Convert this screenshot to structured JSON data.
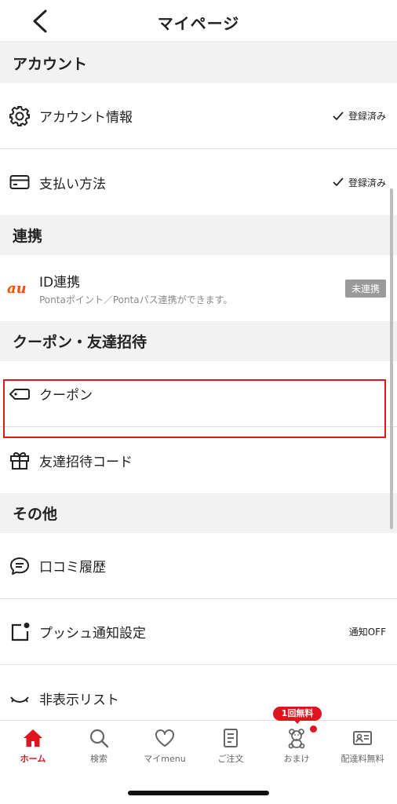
{
  "header": {
    "title": "マイページ"
  },
  "sections": {
    "account": {
      "title": "アカウント",
      "account_info": {
        "label": "アカウント情報",
        "status": "登録済み"
      },
      "payment": {
        "label": "支払い方法",
        "status": "登録済み"
      }
    },
    "link": {
      "title": "連携",
      "id_link": {
        "logo": "au",
        "label": "ID連携",
        "sub": "Pontaポイント／Pontaパス連携ができます。",
        "badge": "未連携"
      }
    },
    "coupon": {
      "title": "クーポン・友達招待",
      "coupon": {
        "label": "クーポン"
      },
      "invite": {
        "label": "友達招待コード"
      }
    },
    "other": {
      "title": "その他",
      "reviews": {
        "label": "口コミ履歴"
      },
      "push": {
        "label": "プッシュ通知設定",
        "status": "通知OFF"
      },
      "hidden": {
        "label": "非表示リスト"
      }
    }
  },
  "tabbar": {
    "promo": "1回無料",
    "tabs": [
      {
        "label": "ホーム",
        "icon": "home-icon",
        "active": true
      },
      {
        "label": "検索",
        "icon": "search-icon"
      },
      {
        "label": "マイmenu",
        "icon": "heart-icon"
      },
      {
        "label": "ご注文",
        "icon": "order-icon"
      },
      {
        "label": "おまけ",
        "icon": "bear-icon"
      },
      {
        "label": "配達料無料",
        "icon": "pass-card-icon"
      }
    ]
  },
  "colors": {
    "accent": "#e0141e",
    "au_orange": "#eb5505",
    "section_bg": "#f2f2f2"
  }
}
